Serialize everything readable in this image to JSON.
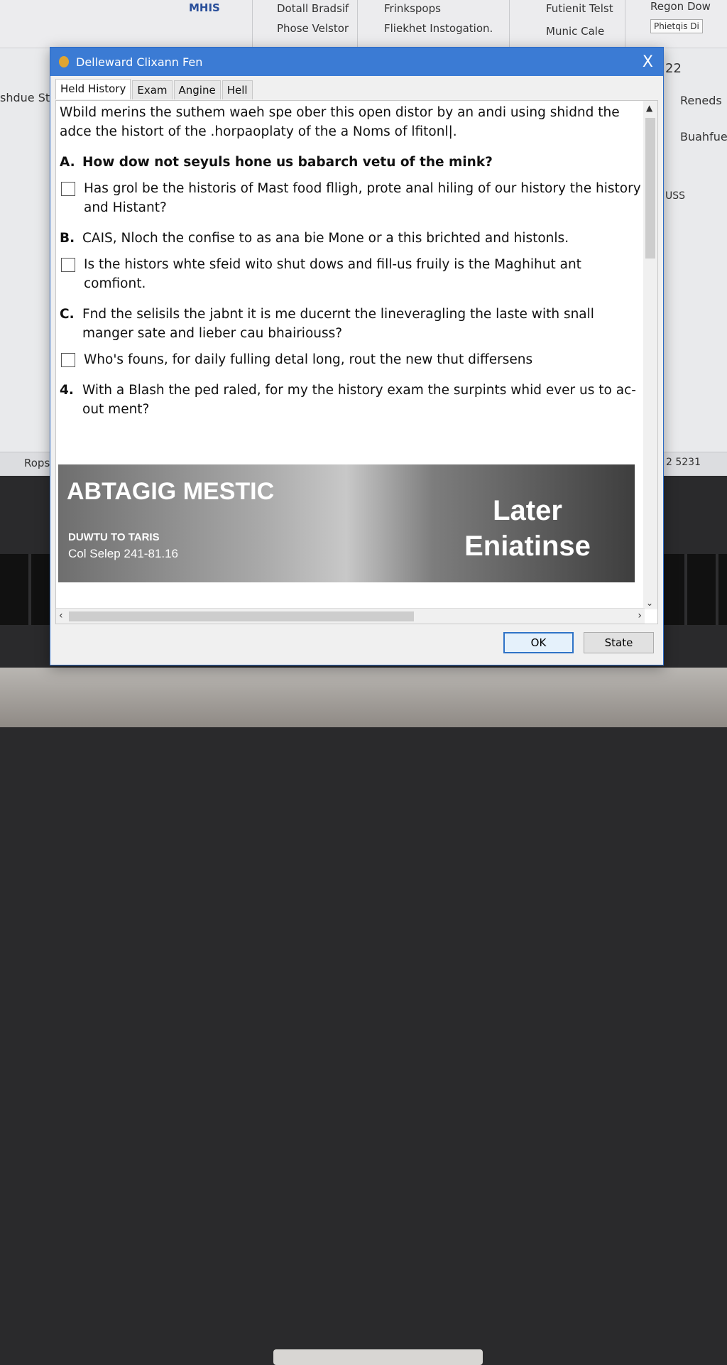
{
  "background": {
    "ribbon": [
      "MHIS",
      "Dotall Bradsif",
      "Phose Velstor",
      "Frinkspops",
      "Fliekhet Instogation.",
      "Futienit Telst",
      "Munic Cale",
      "Regon Dow",
      "Phietqis Di"
    ],
    "left_text": "shdue St",
    "right_items": [
      "22",
      "Reneds",
      "Buahfue",
      "USS"
    ],
    "status_left": "Rops",
    "status_right": "2 5231"
  },
  "dialog": {
    "title": "Delleward Clixann Fen",
    "close_label": "X",
    "tabs": [
      "Held History",
      "Exam",
      "Angine",
      "Hell"
    ],
    "active_tab": 0,
    "intro": "Wbild merins the suthem waeh spe ober this open distor by an andi using shidnd the adce the histort of the .horpaoplaty of the a Noms of lfitonl|.",
    "items": [
      {
        "type": "question",
        "label": "A.",
        "text": "How dow not seyuls hone us babarch vetu of the mink?",
        "bold": true
      },
      {
        "type": "option",
        "text": "Has grol be the historis of Mast food flligh, prote anal hiling of our history the history and Histant?"
      },
      {
        "type": "question",
        "label": "B.",
        "text": "CAIS, Nloch the confise to as ana bie Mone or a this brichted and histonls.",
        "bold": false
      },
      {
        "type": "option",
        "text": "Is the histors whte sfeid wito shut dows and fill-us fruily is the Maghihut ant comfiont."
      },
      {
        "type": "question",
        "label": "C.",
        "text": "Fnd the selisils the jabnt it is me ducernt the lineveragling the laste with snall manger sate and lieber cau bhairiouss?",
        "bold": false
      },
      {
        "type": "option",
        "text": "Who's founs, for daily fulling detal long, rout the new thut differsens"
      },
      {
        "type": "question",
        "label": "4.",
        "text": "With a Blash the ped raled, for my the history exam the surpints whid ever us to ac-out ment?",
        "bold": false
      }
    ],
    "banner": {
      "title": "ABTAGIG MESTIC",
      "subtitle": "DUWTU TO TARIS",
      "caption": "Col Selep 241-81.16",
      "right_text": "Later Eniatinse"
    },
    "buttons": {
      "ok": "OK",
      "state": "State"
    },
    "accent_color": "#3b7bd4"
  }
}
